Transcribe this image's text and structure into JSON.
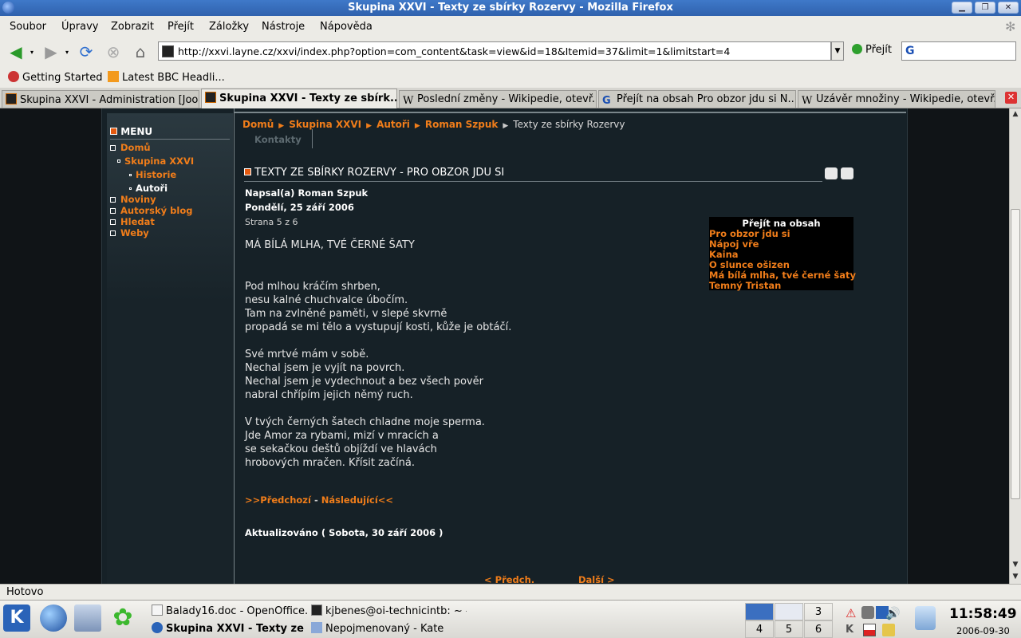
{
  "window": {
    "title": "Skupina XXVI - Texty ze sbírky Rozervy - Mozilla Firefox"
  },
  "menu": [
    "Soubor",
    "Úpravy",
    "Zobrazit",
    "Přejít",
    "Záložky",
    "Nástroje",
    "Nápověda"
  ],
  "nav": {
    "url": "http://xxvi.layne.cz/xxvi/index.php?option=com_content&task=view&id=18&Itemid=37&limit=1&limitstart=4",
    "go_label": "Přejít"
  },
  "bookmarks": [
    "Getting Started",
    "Latest BBC Headli..."
  ],
  "tabs": [
    {
      "label": "Skupina XXVI - Administration [Joo...",
      "active": false
    },
    {
      "label": "Skupina XXVI - Texty ze sbírk...",
      "active": true
    },
    {
      "label": "Poslední změny - Wikipedie, otevř...",
      "active": false
    },
    {
      "label": "Přejít na obsah Pro obzor jdu si N...",
      "active": false
    },
    {
      "label": "Uzávěr množiny - Wikipedie, otevř...",
      "active": false
    }
  ],
  "site": {
    "menu_title": "MENU",
    "menu_items": [
      {
        "label": "Domů",
        "level": 0
      },
      {
        "label": "Skupina XXVI",
        "level": 1
      },
      {
        "label": "Historie",
        "level": 2
      },
      {
        "label": "Autoři",
        "level": 2,
        "current": true
      },
      {
        "label": "Noviny",
        "level": 0
      },
      {
        "label": "Autorský blog",
        "level": 0
      },
      {
        "label": "Hledat",
        "level": 0
      },
      {
        "label": "Weby",
        "level": 0
      }
    ],
    "breadcrumb": [
      "Domů",
      "Skupina XXVI",
      "Autoři",
      "Roman Szpuk"
    ],
    "breadcrumb_current": "Texty ze sbírky Rozervy",
    "kontakty": "Kontakty",
    "article": {
      "title": "TEXTY ZE SBÍRKY ROZERVY - PRO OBZOR JDU SI",
      "author": "Napsal(a) Roman Szpuk",
      "date": "Pondělí, 25 září 2006",
      "page": "Strana 5 z 6",
      "subtitle": "MÁ BÍLÁ MLHA, TVÉ ČERNÉ ŠATY",
      "stanzas": [
        [
          "Pod mlhou kráčím shrben,",
          "nesu kalné chuchvalce úbočím.",
          "Tam na zvlněné paměti, v slepé skvrně",
          "propadá se mi tělo a vystupují kosti, kůže je obtáčí."
        ],
        [
          "Své mrtvé mám v sobě.",
          "Nechal jsem je vyjít na povrch.",
          "Nechal jsem je vydechnout a bez všech pověr",
          "nabral chřípím jejich němý ruch."
        ],
        [
          "V tvých černých šatech chladne moje sperma.",
          "Jde Amor za rybami, mizí v mracích a",
          "se sekačkou deštů objíždí ve hlavách",
          "hrobových mračen. Křísit začíná."
        ]
      ],
      "prev": ">>Předchozí",
      "dash": "-",
      "next": "Následující<<",
      "updated": "Aktualizováno ( Sobota, 30 září 2006 )"
    },
    "toc": {
      "heading": "Přejít na obsah",
      "items": [
        "Pro obzor jdu si",
        "Nápoj vře",
        "Kaina",
        "O slunce ošizen",
        "Má bílá mlha, tvé černé šaty",
        "Temný Tristan"
      ]
    },
    "pager": {
      "prev": "< Předch.",
      "next": "Další >"
    }
  },
  "status": "Hotovo",
  "taskbar": {
    "tasks": [
      "Balady16.doc - OpenOffice.o",
      "kjbenes@oi-technicintb: ~ -",
      "Skupina XXVI - Texty ze s",
      "Nepojmenovaný - Kate"
    ],
    "desktops": [
      "3",
      "4",
      "5",
      "6"
    ],
    "clock": "11:58:49",
    "date": "2006-09-30"
  },
  "colors": {
    "accent": "#f07d1a",
    "page_bg": "#162127",
    "title_bar": "#3565b3"
  }
}
